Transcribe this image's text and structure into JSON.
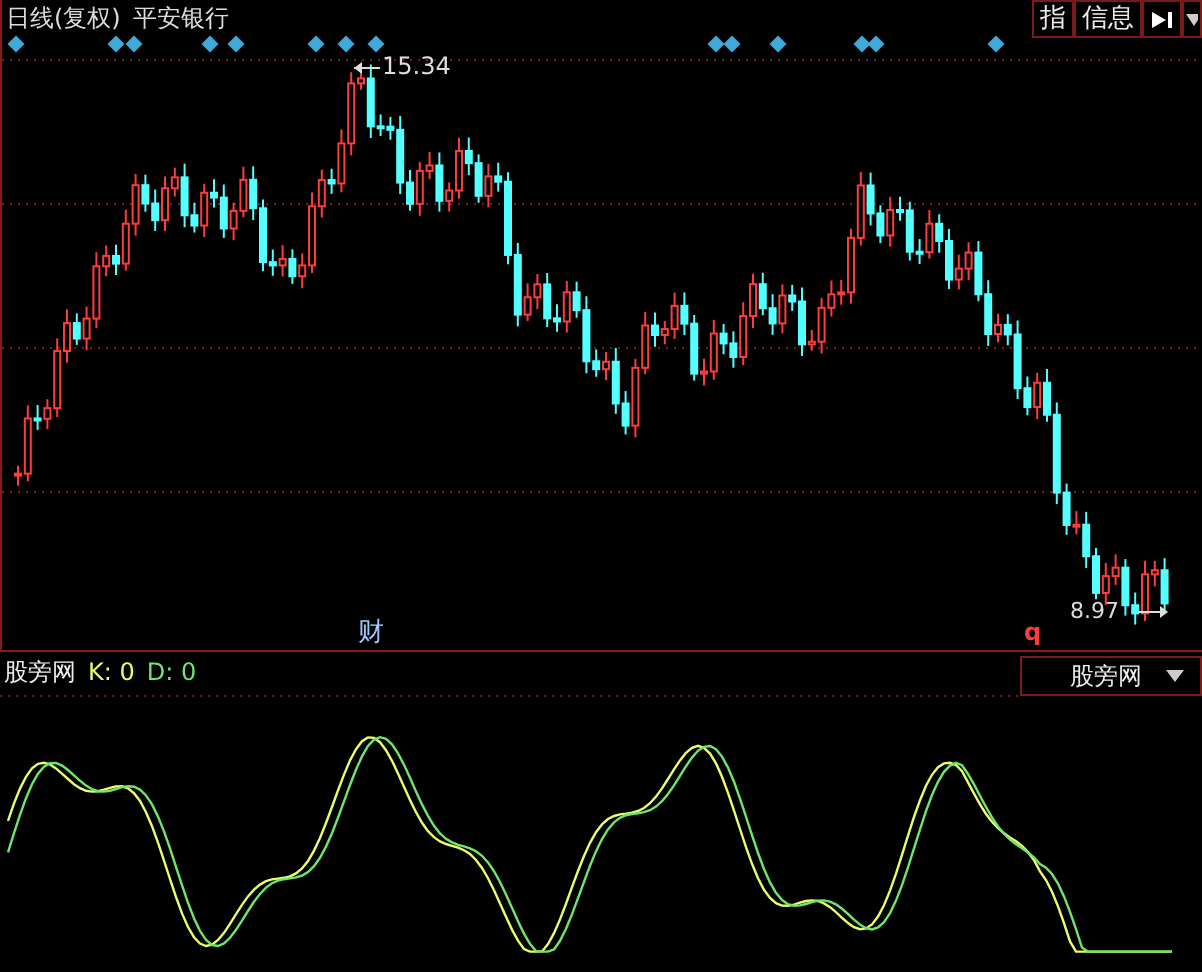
{
  "header": {
    "period": "日线(复权)",
    "stock": "平安银行"
  },
  "toolbar": [
    {
      "label": "指"
    },
    {
      "label": "信息"
    }
  ],
  "chart": {
    "high_label": "15.34",
    "low_label": "8.97",
    "event_marker": "财",
    "corner_marker": "q"
  },
  "indicator": {
    "name": "股旁网",
    "k": "K: 0",
    "d": "D: 0"
  },
  "dropdown": {
    "value": "股旁网"
  }
}
